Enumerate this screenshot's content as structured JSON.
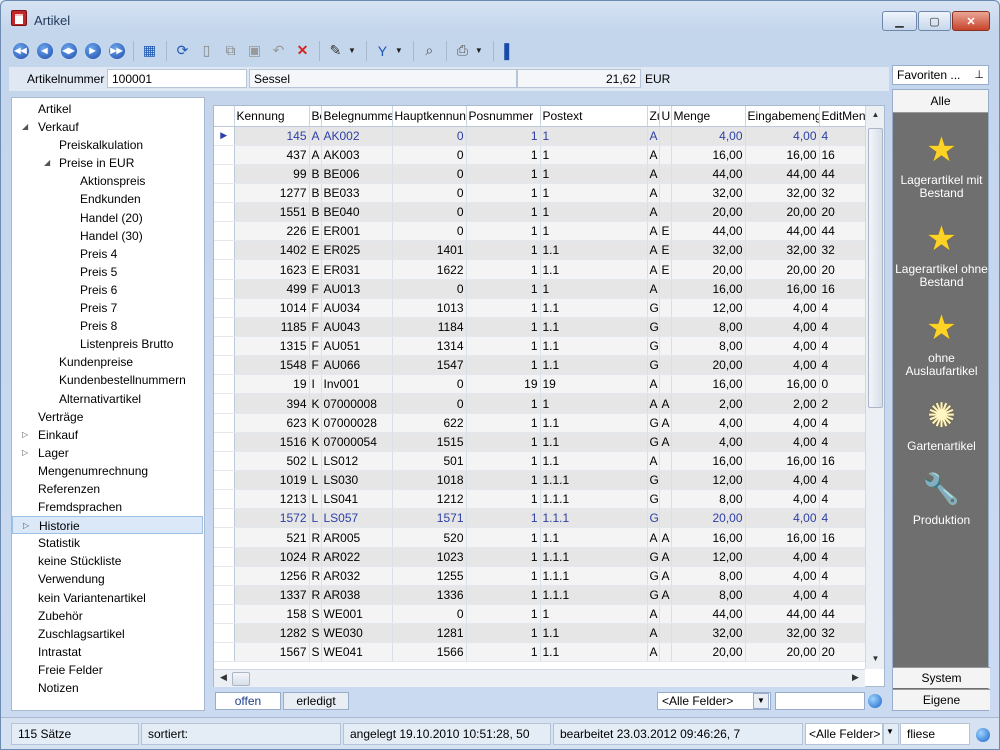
{
  "window": {
    "title": "Artikel"
  },
  "toolbar": {
    "icons": [
      "first-icon",
      "prev-icon",
      "prev-page-icon",
      "next-icon",
      "last-icon",
      "table-icon",
      "refresh-icon",
      "new-icon",
      "copy-icon",
      "save-icon",
      "undo-icon",
      "delete-icon",
      "tools-icon",
      "filter-icon",
      "search-icon",
      "print-icon",
      "book-icon"
    ]
  },
  "header": {
    "label": "Artikelnummer",
    "number": "100001",
    "name": "Sessel",
    "price": "21,62",
    "currency": "EUR"
  },
  "favorites": {
    "dropdown": "Favoriten ...",
    "all": "Alle",
    "system": "System",
    "own": "Eigene",
    "items": [
      {
        "label": "Lagerartikel mit Bestand",
        "icon": "star-icon"
      },
      {
        "label": "Lagerartikel ohne Bestand",
        "icon": "star-icon"
      },
      {
        "label": "ohne Auslaufartikel",
        "icon": "star-icon"
      },
      {
        "label": "Gartenartikel",
        "icon": "sun-icon"
      },
      {
        "label": "Produktion",
        "icon": "wrench-icon"
      }
    ]
  },
  "tree": [
    {
      "label": "Artikel",
      "level": 0,
      "toggle": ""
    },
    {
      "label": "Verkauf",
      "level": 0,
      "toggle": "expanded"
    },
    {
      "label": "Preiskalkulation",
      "level": 1,
      "toggle": ""
    },
    {
      "label": "Preise in EUR",
      "level": 1,
      "toggle": "expanded"
    },
    {
      "label": "Aktionspreis",
      "level": 2,
      "toggle": ""
    },
    {
      "label": "Endkunden",
      "level": 2,
      "toggle": ""
    },
    {
      "label": "Handel (20)",
      "level": 2,
      "toggle": ""
    },
    {
      "label": "Handel (30)",
      "level": 2,
      "toggle": ""
    },
    {
      "label": "Preis 4",
      "level": 2,
      "toggle": ""
    },
    {
      "label": "Preis 5",
      "level": 2,
      "toggle": ""
    },
    {
      "label": "Preis 6",
      "level": 2,
      "toggle": ""
    },
    {
      "label": "Preis 7",
      "level": 2,
      "toggle": ""
    },
    {
      "label": "Preis 8",
      "level": 2,
      "toggle": ""
    },
    {
      "label": "Listenpreis Brutto",
      "level": 2,
      "toggle": ""
    },
    {
      "label": "Kundenpreise",
      "level": 1,
      "toggle": ""
    },
    {
      "label": "Kundenbestellnummern",
      "level": 1,
      "toggle": ""
    },
    {
      "label": "Alternativartikel",
      "level": 1,
      "toggle": ""
    },
    {
      "label": "Verträge",
      "level": 0,
      "toggle": ""
    },
    {
      "label": "Einkauf",
      "level": 0,
      "toggle": "collapsed"
    },
    {
      "label": "Lager",
      "level": 0,
      "toggle": "collapsed"
    },
    {
      "label": "Mengenumrechnung",
      "level": 0,
      "toggle": ""
    },
    {
      "label": "Referenzen",
      "level": 0,
      "toggle": ""
    },
    {
      "label": "Fremdsprachen",
      "level": 0,
      "toggle": ""
    },
    {
      "label": "Historie",
      "level": 0,
      "toggle": "collapsed",
      "selected": true
    },
    {
      "label": "Statistik",
      "level": 0,
      "toggle": ""
    },
    {
      "label": "keine Stückliste",
      "level": 0,
      "toggle": ""
    },
    {
      "label": "Verwendung",
      "level": 0,
      "toggle": ""
    },
    {
      "label": "kein Variantenartikel",
      "level": 0,
      "toggle": ""
    },
    {
      "label": "Zubehör",
      "level": 0,
      "toggle": ""
    },
    {
      "label": "Zuschlagsartikel",
      "level": 0,
      "toggle": ""
    },
    {
      "label": "Intrastat",
      "level": 0,
      "toggle": ""
    },
    {
      "label": "Freie Felder",
      "level": 0,
      "toggle": ""
    },
    {
      "label": "Notizen",
      "level": 0,
      "toggle": ""
    }
  ],
  "grid": {
    "columns": [
      "Kennung",
      "Be",
      "Belegnummer",
      "Hauptkennung",
      "Posnummer",
      "Postext",
      "Zu",
      "U",
      "Menge",
      "Eingabemenge",
      "EditMen"
    ],
    "rows": [
      [
        "145",
        "A",
        "AK002",
        "0",
        "1",
        "1",
        "A",
        "",
        "4,00",
        "4,00",
        "4"
      ],
      [
        "437",
        "A",
        "AK003",
        "0",
        "1",
        "1",
        "A",
        "",
        "16,00",
        "16,00",
        "16"
      ],
      [
        "99",
        "B",
        "BE006",
        "0",
        "1",
        "1",
        "A",
        "",
        "44,00",
        "44,00",
        "44"
      ],
      [
        "1277",
        "B",
        "BE033",
        "0",
        "1",
        "1",
        "A",
        "",
        "32,00",
        "32,00",
        "32"
      ],
      [
        "1551",
        "B",
        "BE040",
        "0",
        "1",
        "1",
        "A",
        "",
        "20,00",
        "20,00",
        "20"
      ],
      [
        "226",
        "E",
        "ER001",
        "0",
        "1",
        "1",
        "A",
        "E",
        "44,00",
        "44,00",
        "44"
      ],
      [
        "1402",
        "E",
        "ER025",
        "1401",
        "1",
        "1.1",
        "A",
        "E",
        "32,00",
        "32,00",
        "32"
      ],
      [
        "1623",
        "E",
        "ER031",
        "1622",
        "1",
        "1.1",
        "A",
        "E",
        "20,00",
        "20,00",
        "20"
      ],
      [
        "499",
        "F",
        "AU013",
        "0",
        "1",
        "1",
        "A",
        "",
        "16,00",
        "16,00",
        "16"
      ],
      [
        "1014",
        "F",
        "AU034",
        "1013",
        "1",
        "1.1",
        "G",
        "",
        "12,00",
        "4,00",
        "4"
      ],
      [
        "1185",
        "F",
        "AU043",
        "1184",
        "1",
        "1.1",
        "G",
        "",
        "8,00",
        "4,00",
        "4"
      ],
      [
        "1315",
        "F",
        "AU051",
        "1314",
        "1",
        "1.1",
        "G",
        "",
        "8,00",
        "4,00",
        "4"
      ],
      [
        "1548",
        "F",
        "AU066",
        "1547",
        "1",
        "1.1",
        "G",
        "",
        "20,00",
        "4,00",
        "4"
      ],
      [
        "19",
        "I",
        "Inv001",
        "0",
        "19",
        "19",
        "A",
        "",
        "16,00",
        "16,00",
        "0"
      ],
      [
        "394",
        "K",
        "07000008",
        "0",
        "1",
        "1",
        "A",
        "A",
        "2,00",
        "2,00",
        "2"
      ],
      [
        "623",
        "K",
        "07000028",
        "622",
        "1",
        "1.1",
        "G",
        "A",
        "4,00",
        "4,00",
        "4"
      ],
      [
        "1516",
        "K",
        "07000054",
        "1515",
        "1",
        "1.1",
        "G",
        "A",
        "4,00",
        "4,00",
        "4"
      ],
      [
        "502",
        "L",
        "LS012",
        "501",
        "1",
        "1.1",
        "A",
        "",
        "16,00",
        "16,00",
        "16"
      ],
      [
        "1019",
        "L",
        "LS030",
        "1018",
        "1",
        "1.1.1",
        "G",
        "",
        "12,00",
        "4,00",
        "4"
      ],
      [
        "1213",
        "L",
        "LS041",
        "1212",
        "1",
        "1.1.1",
        "G",
        "",
        "8,00",
        "4,00",
        "4"
      ],
      [
        "1572",
        "L",
        "LS057",
        "1571",
        "1",
        "1.1.1",
        "G",
        "",
        "20,00",
        "4,00",
        "4"
      ],
      [
        "521",
        "R",
        "AR005",
        "520",
        "1",
        "1.1",
        "A",
        "A",
        "16,00",
        "16,00",
        "16"
      ],
      [
        "1024",
        "R",
        "AR022",
        "1023",
        "1",
        "1.1.1",
        "G",
        "A",
        "12,00",
        "4,00",
        "4"
      ],
      [
        "1256",
        "R",
        "AR032",
        "1255",
        "1",
        "1.1.1",
        "G",
        "A",
        "8,00",
        "4,00",
        "4"
      ],
      [
        "1337",
        "R",
        "AR038",
        "1336",
        "1",
        "1.1.1",
        "G",
        "A",
        "8,00",
        "4,00",
        "4"
      ],
      [
        "158",
        "S",
        "WE001",
        "0",
        "1",
        "1",
        "A",
        "",
        "44,00",
        "44,00",
        "44"
      ],
      [
        "1282",
        "S",
        "WE030",
        "1281",
        "1",
        "1.1",
        "A",
        "",
        "32,00",
        "32,00",
        "32"
      ],
      [
        "1567",
        "S",
        "WE041",
        "1566",
        "1",
        "1.1",
        "A",
        "",
        "20,00",
        "20,00",
        "20"
      ]
    ]
  },
  "filterbar": {
    "tab_open": "offen",
    "tab_done": "erledigt",
    "field_select": "<Alle Felder>"
  },
  "status": {
    "count": "115 Sätze",
    "sorted": "sortiert:",
    "created": "angelegt 19.10.2010 10:51:28, 50",
    "edited": "bearbeitet 23.03.2012 09:46:26,  7",
    "field_select": "<Alle Felder>",
    "search_value": "fliese"
  }
}
